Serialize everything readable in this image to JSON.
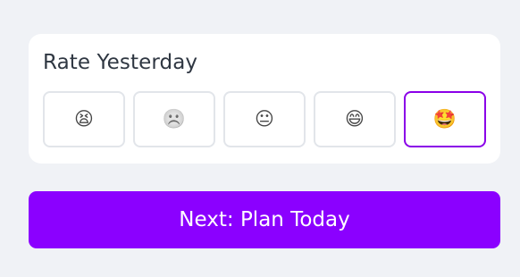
{
  "rating_card": {
    "title": "Rate Yesterday",
    "options": [
      {
        "emoji": "😫",
        "icon": "tired-face-icon",
        "selected": false
      },
      {
        "emoji": "☹️",
        "icon": "frowning-face-icon",
        "selected": false
      },
      {
        "emoji": "😐",
        "icon": "neutral-face-icon",
        "selected": false
      },
      {
        "emoji": "😄",
        "icon": "grinning-face-icon",
        "selected": false
      },
      {
        "emoji": "🤩",
        "icon": "star-struck-face-icon",
        "selected": true
      }
    ],
    "selected_index": 4
  },
  "actions": {
    "next_label": "Next: Plan Today"
  },
  "colors": {
    "accent": "#8b00ff",
    "selected_border": "#8a00e8",
    "card_background": "#ffffff",
    "page_background": "#f0f2f6",
    "option_border": "#e2e5ea",
    "title_text": "#2f3742"
  }
}
